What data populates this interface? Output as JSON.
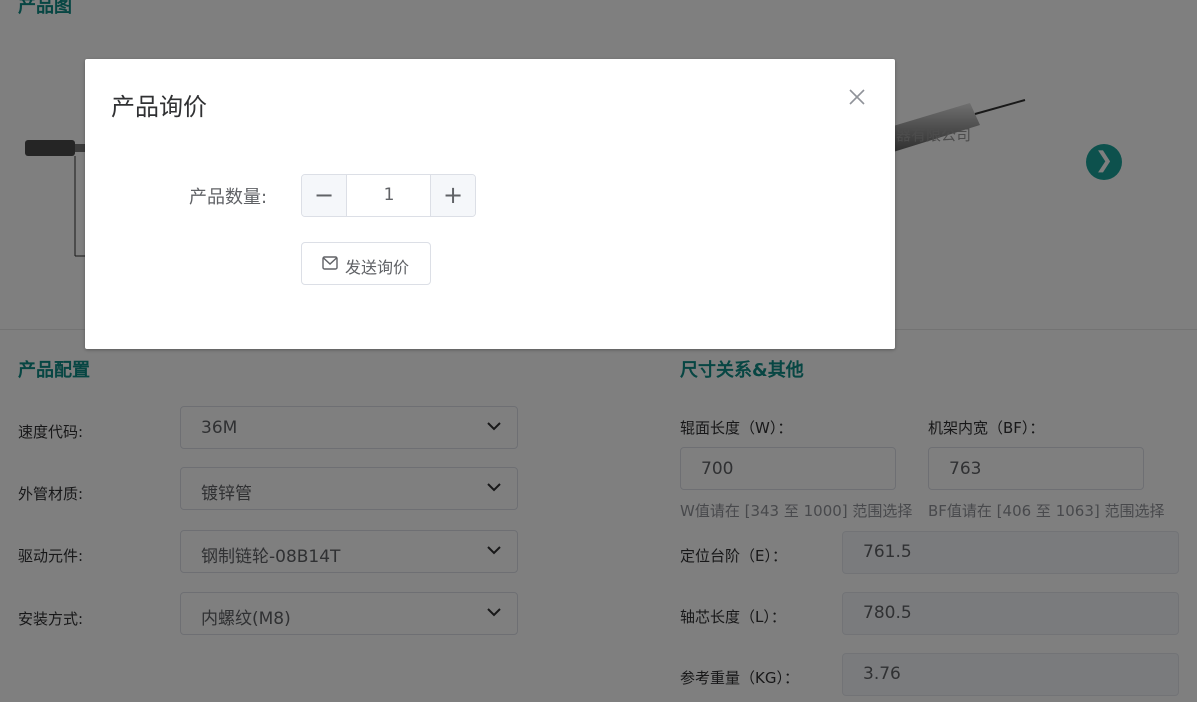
{
  "sections": {
    "image_title": "产品图",
    "config_title": "产品配置",
    "dimension_title": "尺寸关系&其他"
  },
  "image_area": {
    "watermark": "器有限公司",
    "next_arrow": "❯"
  },
  "config": {
    "speed_label": "速度代码:",
    "speed_value": "36M",
    "material_label": "外管材质:",
    "material_value": "镀锌管",
    "drive_label": "驱动元件:",
    "drive_value": "钢制链轮-08B14T",
    "mount_label": "安装方式:",
    "mount_value": "内螺纹(M8)"
  },
  "dimensions": {
    "w_label": "辊面长度（W）：",
    "w_value": "700",
    "w_hint": "W值请在 [343 至 1000] 范围选择",
    "bf_label": "机架内宽（BF）：",
    "bf_value": "763",
    "bf_hint": "BF值请在 [406 至 1063] 范围选择",
    "e_label": "定位台阶（E）：",
    "e_value": "761.5",
    "l_label": "轴芯长度（L）：",
    "l_value": "780.5",
    "kg_label": "参考重量（KG）：",
    "kg_value": "3.76"
  },
  "dialog": {
    "title": "产品询价",
    "qty_label": "产品数量:",
    "qty_value": "1",
    "minus": "−",
    "plus": "+",
    "send_label": "发送询价"
  },
  "colors": {
    "accent": "#0e8c86",
    "overlay": "rgba(0,0,0,0.5)"
  }
}
